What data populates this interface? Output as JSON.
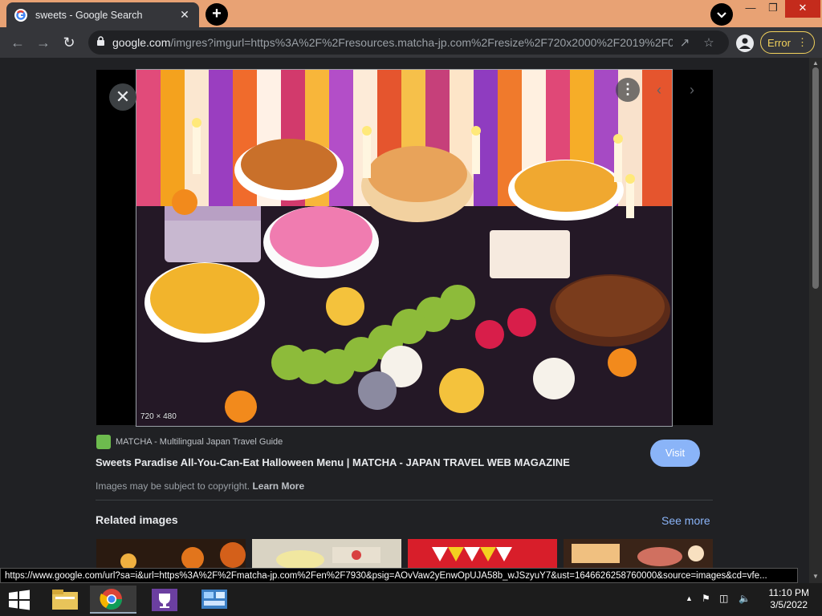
{
  "browser": {
    "tab_title": "sweets - Google Search",
    "url_host": "google.com",
    "url_path": "/imgres?imgurl=https%3A%2F%2Fresources.matcha-jp.com%2Fresize%2F720x2000%2F2019%2F09...",
    "error_label": "Error",
    "tab_close": "✕",
    "new_tab": "+"
  },
  "viewer": {
    "dimensions": "720 × 480",
    "close_glyph": "✕"
  },
  "result": {
    "source_name": "MATCHA - Multilingual Japan Travel Guide",
    "title": "Sweets Paradise All-You-Can-Eat Halloween Menu | MATCHA - JAPAN TRAVEL WEB MAGAZINE",
    "visit_label": "Visit",
    "copyright_text": "Images may be subject to copyright.",
    "learn_more": "Learn More"
  },
  "related": {
    "title": "Related images",
    "see_more": "See more"
  },
  "status_link": "https://www.google.com/url?sa=i&url=https%3A%2F%2Fmatcha-jp.com%2Fen%2F7930&psig=AOvVaw2yEnwOpUJA58b_wJSzyuY7&ust=1646626258760000&source=images&cd=vfe...",
  "taskbar": {
    "time": "11:10 PM",
    "date": "3/5/2022"
  },
  "colors": {
    "accent": "#8ab4f8",
    "tabstrip": "#e8a274",
    "error": "#f2d25c"
  }
}
